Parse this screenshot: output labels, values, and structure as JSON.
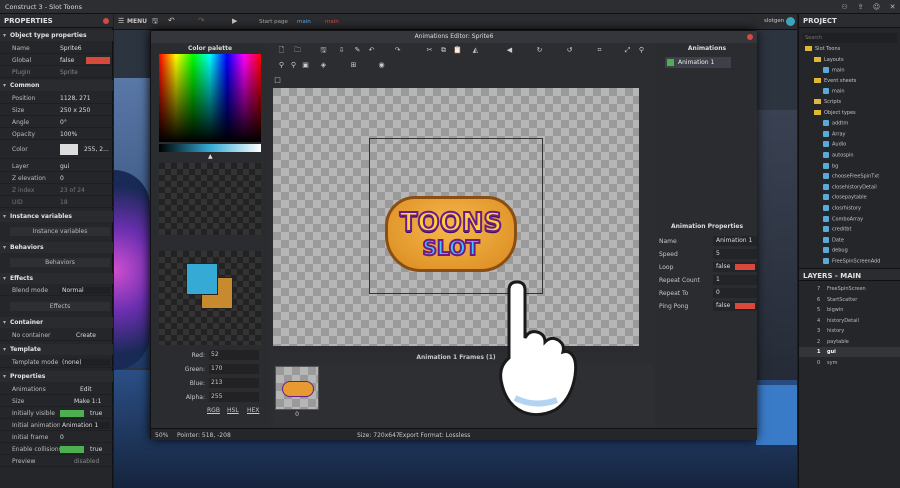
{
  "app": {
    "title": "Construct 3 - Slot Toons",
    "user": "slotgen"
  },
  "toolbar": {
    "menu_label": "MENU",
    "tabs": [
      "Start page",
      "main",
      "main"
    ]
  },
  "properties": {
    "header": "PROPERTIES",
    "sections": {
      "object_type": "Object type properties",
      "common": "Common",
      "instance_vars": "Instance variables",
      "behaviors": "Behaviors",
      "effects": "Effects",
      "container": "Container",
      "template": "Template",
      "properties": "Properties"
    },
    "rows": {
      "name": {
        "k": "Name",
        "v": "Sprite6"
      },
      "global": {
        "k": "Global",
        "v": "false"
      },
      "plugin": {
        "k": "Plugin",
        "v": "Sprite"
      },
      "position": {
        "k": "Position",
        "v": "1128, 271"
      },
      "size": {
        "k": "Size",
        "v": "250 x 250"
      },
      "angle": {
        "k": "Angle",
        "v": "0°"
      },
      "opacity": {
        "k": "Opacity",
        "v": "100%"
      },
      "color": {
        "k": "Color",
        "v": "255, 2..."
      },
      "layer": {
        "k": "Layer",
        "v": "gui"
      },
      "zelev": {
        "k": "Z elevation",
        "v": "0"
      },
      "zindex": {
        "k": "Z index",
        "v": "23 of 24"
      },
      "uid": {
        "k": "UID",
        "v": "18"
      },
      "blend": {
        "k": "Blend mode",
        "v": "Normal"
      },
      "container": {
        "k": "No container",
        "v": "Create"
      },
      "template_mode": {
        "k": "Template mode",
        "v": "(none)"
      },
      "animations": {
        "k": "Animations",
        "v": "Edit"
      },
      "size2": {
        "k": "Size",
        "v": "Make 1:1"
      },
      "visible": {
        "k": "Initially visible",
        "v": "true"
      },
      "init_anim": {
        "k": "Initial animation",
        "v": "Animation 1"
      },
      "init_frame": {
        "k": "Initial frame",
        "v": "0"
      },
      "collisions": {
        "k": "Enable collisions",
        "v": "true"
      },
      "preview": {
        "k": "Preview",
        "v": "disabled"
      }
    },
    "buttons": {
      "instance_vars": "Instance variables",
      "behaviors": "Behaviors",
      "effects": "Effects"
    }
  },
  "dialog": {
    "title": "Animations Editor: Sprite6",
    "palette_title": "Color palette",
    "rgb": {
      "red_label": "Red:",
      "red": "52",
      "green_label": "Green:",
      "green": "170",
      "blue_label": "Blue:",
      "blue": "213",
      "alpha_label": "Alpha:",
      "alpha": "255"
    },
    "color_modes": [
      "RGB",
      "HSL",
      "HEX"
    ],
    "frames_title": "Animation 1 Frames (1)",
    "frame_index": "0",
    "animations_title": "Animations",
    "anim_item": "Animation 1",
    "anim_props_title": "Animation Properties",
    "anim_props": [
      {
        "k": "Name",
        "v": "Animation 1"
      },
      {
        "k": "Speed",
        "v": "5"
      },
      {
        "k": "Loop",
        "v": "false"
      },
      {
        "k": "Repeat Count",
        "v": "1"
      },
      {
        "k": "Repeat To",
        "v": "0"
      },
      {
        "k": "Ping Pong",
        "v": "false"
      }
    ],
    "status": {
      "zoom": "50%",
      "pointer": "Pointer: 518, -208",
      "size": "Size: 720x647",
      "format": "Export Format: Lossless"
    },
    "logo_line1": "TOONS",
    "logo_line2": "SLOT"
  },
  "project": {
    "header": "PROJECT",
    "search_placeholder": "Search",
    "tree": [
      {
        "label": "Slot Toons",
        "kind": "folder",
        "indent": 0
      },
      {
        "label": "Layouts",
        "kind": "folder",
        "indent": 1
      },
      {
        "label": "main",
        "kind": "obj",
        "indent": 2
      },
      {
        "label": "Event sheets",
        "kind": "folder",
        "indent": 1
      },
      {
        "label": "main",
        "kind": "obj",
        "indent": 2
      },
      {
        "label": "Scripts",
        "kind": "folder",
        "indent": 1
      },
      {
        "label": "Object types",
        "kind": "folder",
        "indent": 1
      },
      {
        "label": "addtm",
        "kind": "obj",
        "indent": 2
      },
      {
        "label": "Array",
        "kind": "obj",
        "indent": 2
      },
      {
        "label": "Audio",
        "kind": "obj",
        "indent": 2
      },
      {
        "label": "autospin",
        "kind": "obj",
        "indent": 2
      },
      {
        "label": "bg",
        "kind": "obj",
        "indent": 2
      },
      {
        "label": "chooseFreeSpinTxt",
        "kind": "obj",
        "indent": 2
      },
      {
        "label": "closehistoryDetail",
        "kind": "obj",
        "indent": 2
      },
      {
        "label": "closepaytable",
        "kind": "obj",
        "indent": 2
      },
      {
        "label": "closrhistory",
        "kind": "obj",
        "indent": 2
      },
      {
        "label": "ComboArray",
        "kind": "obj",
        "indent": 2
      },
      {
        "label": "creditbt",
        "kind": "obj",
        "indent": 2
      },
      {
        "label": "Date",
        "kind": "obj",
        "indent": 2
      },
      {
        "label": "debug",
        "kind": "obj",
        "indent": 2
      },
      {
        "label": "FreeSpinScreenAdd",
        "kind": "obj",
        "indent": 2
      }
    ],
    "layers_header": "LAYERS - MAIN",
    "layers": [
      {
        "i": "7",
        "n": "FreeSpinScreen"
      },
      {
        "i": "6",
        "n": "StartScatter"
      },
      {
        "i": "5",
        "n": "bigwin"
      },
      {
        "i": "4",
        "n": "historyDetail"
      },
      {
        "i": "3",
        "n": "history"
      },
      {
        "i": "2",
        "n": "paytable"
      },
      {
        "i": "1",
        "n": "gui"
      },
      {
        "i": "0",
        "n": "sym"
      }
    ]
  }
}
